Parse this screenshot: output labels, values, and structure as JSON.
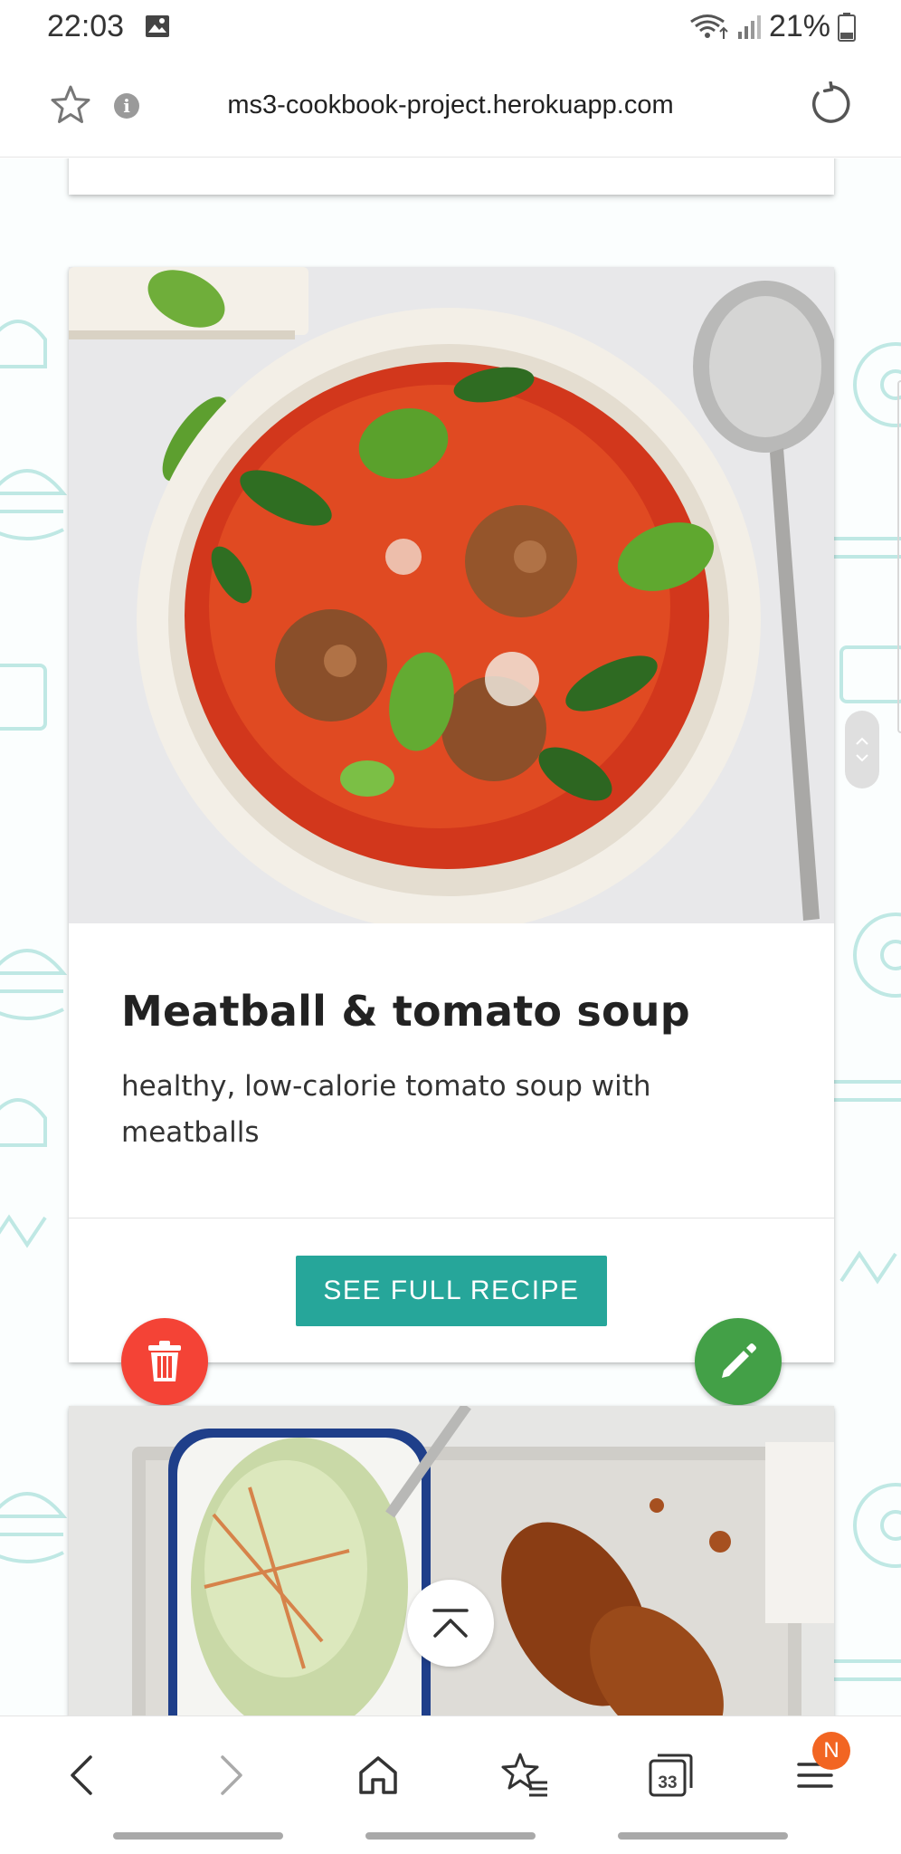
{
  "status_bar": {
    "time": "22:03",
    "battery": "21%",
    "icons": [
      "gallery-icon",
      "wifi-icon",
      "signal-icon",
      "battery-icon"
    ]
  },
  "browser": {
    "url": "ms3-cookbook-project.herokuapp.com",
    "tab_count": "33",
    "menu_badge": "N",
    "icons": [
      "star-icon",
      "info-icon",
      "reload-icon",
      "back-icon",
      "forward-icon",
      "home-icon",
      "bookmarks-icon",
      "tabs-icon",
      "menu-icon"
    ]
  },
  "recipe": {
    "title": "Meatball & tomato soup",
    "description": "healthy, low-calorie tomato soup with meatballs",
    "button_label": "SEE FULL RECIPE"
  },
  "colors": {
    "accent_teal": "#26a69a",
    "delete_red": "#f44336",
    "edit_green": "#43a047",
    "badge_orange": "#f26522",
    "pattern_teal": "#bfe8e4"
  }
}
